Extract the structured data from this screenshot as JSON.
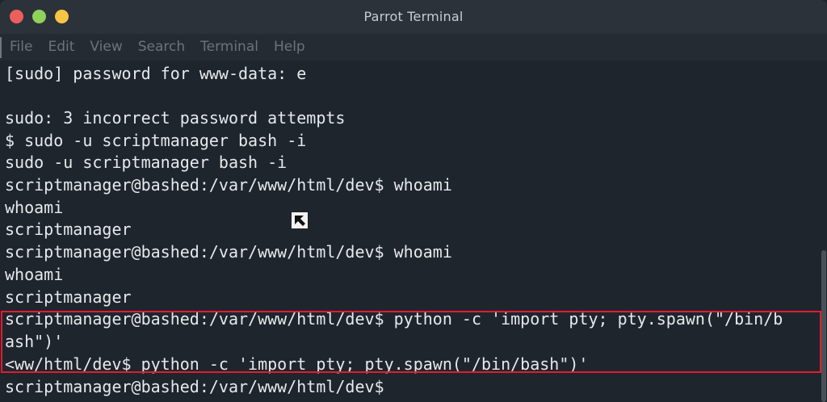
{
  "window": {
    "title": "Parrot Terminal"
  },
  "menu": {
    "items": [
      "File",
      "Edit",
      "View",
      "Search",
      "Terminal",
      "Help"
    ]
  },
  "terminal": {
    "lines": [
      "[sudo] password for www-data: e",
      "",
      "sudo: 3 incorrect password attempts",
      "$ sudo -u scriptmanager bash -i",
      "sudo -u scriptmanager bash -i",
      "scriptmanager@bashed:/var/www/html/dev$ whoami",
      "whoami",
      "scriptmanager",
      "scriptmanager@bashed:/var/www/html/dev$ whoami",
      "whoami",
      "scriptmanager",
      "scriptmanager@bashed:/var/www/html/dev$ python -c 'import pty; pty.spawn(\"/bin/b",
      "ash\")'",
      "<ww/html/dev$ python -c 'import pty; pty.spawn(\"/bin/bash\")'",
      "scriptmanager@bashed:/var/www/html/dev$"
    ]
  },
  "colors": {
    "background": "#1f252d",
    "titlebar": "#2c323a",
    "text": "#e6e9ec",
    "menu_text": "#6b737c",
    "highlight_border": "#e01e2f",
    "close": "#ec5f5d",
    "minimize": "#8ed25a",
    "maximize": "#f6c543"
  }
}
